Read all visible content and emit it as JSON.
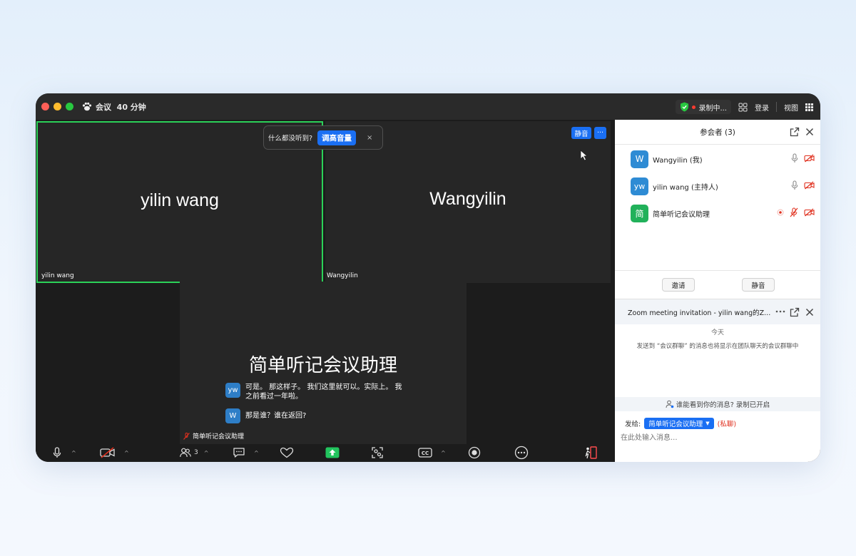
{
  "titlebar": {
    "meeting_label": "会议",
    "time_left": "40 分钟",
    "recording": "录制中...",
    "login": "登录",
    "view": "视图"
  },
  "stage": {
    "tiles": [
      {
        "display_name": "yilin wang",
        "label": "yilin wang"
      },
      {
        "display_name": "Wangyilin",
        "label": "Wangyilin"
      },
      {
        "display_name": "简单听记会议助理",
        "label": "简单听记会议助理"
      }
    ],
    "tooltip": {
      "question": "什么都没听到?",
      "action": "调高音量",
      "close": "×"
    },
    "tile_mute": "静音",
    "tile_more": "···",
    "captions": [
      {
        "avatar": "yw",
        "line1": "可是。 那这样子。 我们这里就可以。实际上。 我",
        "line2": "之前看过一年啦。"
      },
      {
        "avatar": "W",
        "line1": "那是谁？谁在返回?",
        "line2": ""
      }
    ]
  },
  "toolbar": {
    "participants_count": "3"
  },
  "panel": {
    "title": "参会者 (3)",
    "participants": [
      {
        "avatar": "W",
        "name": "Wangyilin (我)",
        "color": "#2e8bd4"
      },
      {
        "avatar": "yw",
        "name": "yilin wang (主持人)",
        "color": "#2e8bd4"
      },
      {
        "avatar": "简",
        "name": "简单听记会议助理",
        "color": "#21b15a"
      }
    ],
    "invite": "邀请",
    "mute_all": "静音",
    "chat": {
      "title": "Zoom meeting invitation - yilin wang的Z...",
      "date": "今天",
      "note": "发送到 “会议群聊” 的消息也将显示在团队聊天的会议群聊中",
      "privacy": "谁能看到你的消息? 录制已开启",
      "send_to_label": "发给:",
      "recipient": "简单听记会议助理",
      "private_tag": "(私聊)",
      "placeholder": "在此处输入消息..."
    }
  },
  "colors": {
    "accent": "#1a6ff3",
    "active_speaker": "#2bd158",
    "recording": "#ff3b30",
    "muted": "#e0301e"
  }
}
